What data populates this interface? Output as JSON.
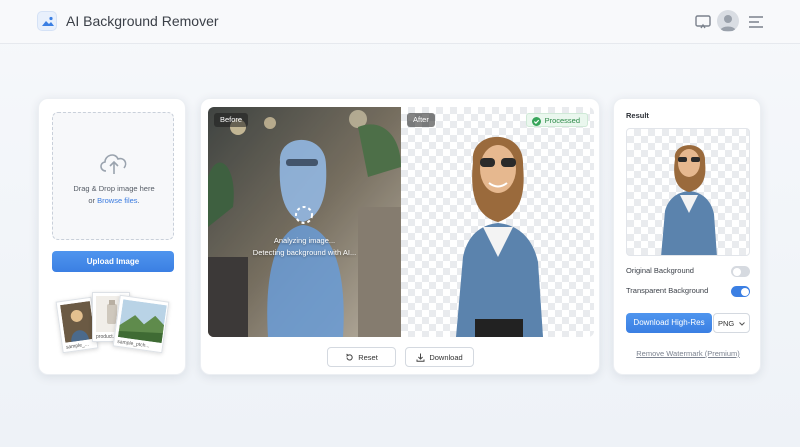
{
  "header": {
    "title": "AI Background Remover",
    "icons": [
      "image-logo-icon",
      "cast-icon",
      "user-avatar-icon",
      "menu-icon"
    ]
  },
  "upload": {
    "drop_text": "Drag & Drop image here",
    "or_text": "or",
    "browse_link": "Browse files",
    "period": ".",
    "upload_button": "Upload Image",
    "samples": [
      {
        "caption": "sample_..."
      },
      {
        "caption": "product..."
      },
      {
        "caption": "sample_ptch..."
      }
    ]
  },
  "preview": {
    "before_label": "Before",
    "after_label": "After",
    "status_badge": "Processed",
    "analyzing_title": "Analyzing image...",
    "analyzing_sub": "Detecting background with AI...",
    "reset_button": "Reset",
    "download_button": "Download"
  },
  "result": {
    "title": "Result",
    "option_original": "Original Background",
    "option_original_on": false,
    "option_transparent": "Transparent Background",
    "option_transparent_on": true,
    "download_hires": "Download High-Res",
    "format": "PNG",
    "remove_watermark": "Remove Watermark (Premium)"
  },
  "colors": {
    "accent": "#3b7fe3",
    "success": "#2d8a48",
    "toggle_off": "#d6dae0"
  }
}
